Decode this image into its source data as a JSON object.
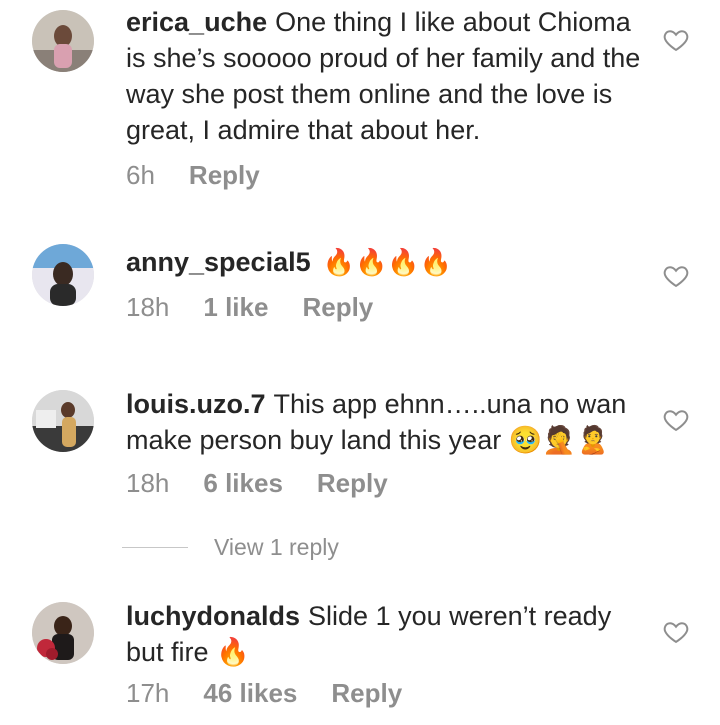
{
  "comments": [
    {
      "username": "erica_uche",
      "text": "One thing I like about Chioma is she’s sooooo proud of her family and the way she post them online and the love is great, I admire that about her.",
      "time": "6h",
      "likes": "",
      "reply_label": "Reply"
    },
    {
      "username": "anny_special5",
      "text": "🔥🔥🔥🔥",
      "time": "18h",
      "likes": "1 like",
      "reply_label": "Reply"
    },
    {
      "username": "louis.uzo.7",
      "text": "This app ehnn…..una no wan make person buy land this year 🥹🤦🙎",
      "time": "18h",
      "likes": "6 likes",
      "reply_label": "Reply"
    },
    {
      "username": "luchydonalds",
      "text": "Slide 1 you weren’t ready but fire 🔥",
      "time": "17h",
      "likes": "46 likes",
      "reply_label": "Reply"
    }
  ],
  "view_replies": "View 1 reply",
  "colors": {
    "text": "#262626",
    "meta": "#8e8e8e",
    "divider": "#c7c7c7"
  },
  "icons": {
    "like": "heart-outline-icon"
  }
}
